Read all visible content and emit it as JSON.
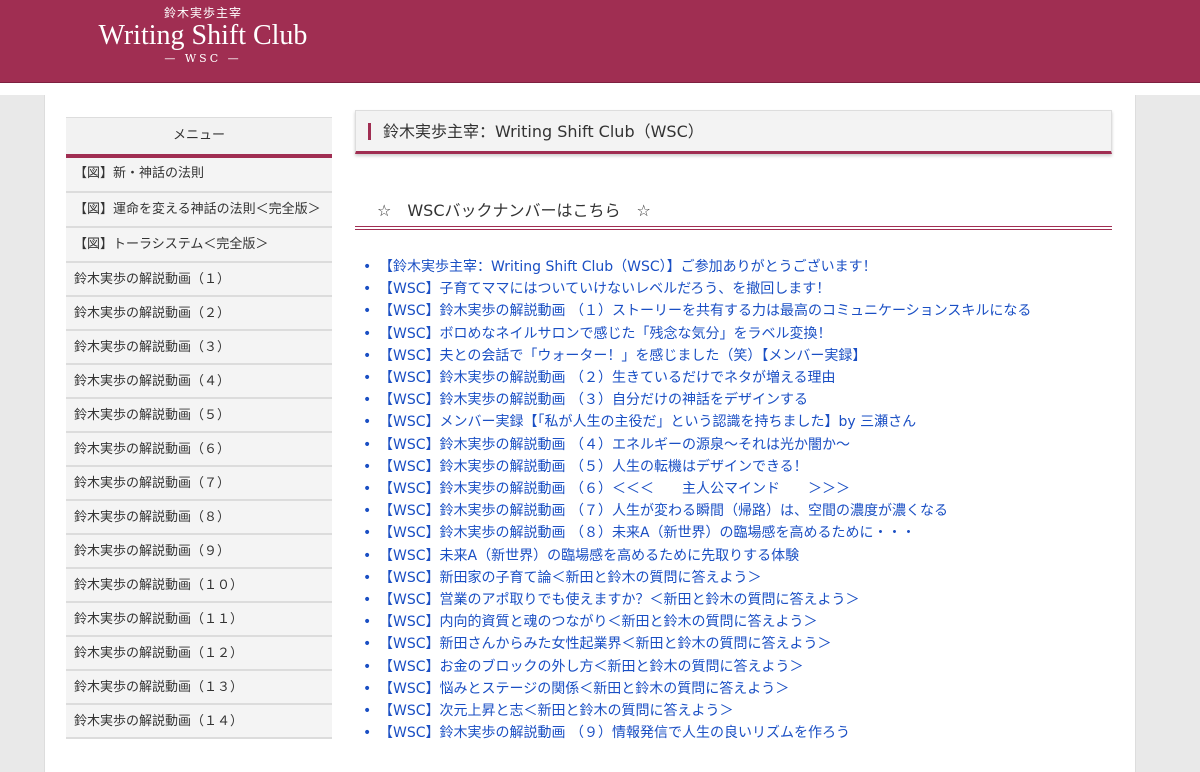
{
  "header": {
    "logo_top": "鈴木実歩主宰",
    "logo_main": "Writing Shift Club",
    "logo_sub": "— WSC —"
  },
  "sidebar": {
    "title": "メニュー",
    "items": [
      "【図】新・神話の法則",
      "【図】運命を変える神話の法則＜完全版＞",
      "【図】トーラシステム＜完全版＞",
      "鈴木実歩の解説動画（１）",
      "鈴木実歩の解説動画（２）",
      "鈴木実歩の解説動画（３）",
      "鈴木実歩の解説動画（４）",
      "鈴木実歩の解説動画（５）",
      "鈴木実歩の解説動画（６）",
      "鈴木実歩の解説動画（７）",
      "鈴木実歩の解説動画（８）",
      "鈴木実歩の解説動画（９）",
      "鈴木実歩の解説動画（１０）",
      "鈴木実歩の解説動画（１１）",
      "鈴木実歩の解説動画（１２）",
      "鈴木実歩の解説動画（１３）",
      "鈴木実歩の解説動画（１４）"
    ]
  },
  "main": {
    "page_title": "鈴木実歩主宰：Writing Shift Club（WSC）",
    "section_title": "☆　WSCバックナンバーはこちら　☆",
    "bullet": "•",
    "links": [
      "【鈴木実歩主宰：Writing Shift Club（WSC）】ご参加ありがとうございます！",
      "【WSC】子育てママにはついていけないレベルだろう、を撤回します！",
      "【WSC】鈴木実歩の解説動画 （１）ストーリーを共有する力は最高のコミュニケーションスキルになる",
      "【WSC】ボロめなネイルサロンで感じた「残念な気分」をラベル変換！",
      "【WSC】夫との会話で「ウォーター！」を感じました（笑）【メンバー実録】",
      "【WSC】鈴木実歩の解説動画 （２）生きているだけでネタが増える理由",
      "【WSC】鈴木実歩の解説動画 （３）自分だけの神話をデザインする",
      "【WSC】メンバー実録【「私が人生の主役だ」という認識を持ちました】by 三瀬さん",
      "【WSC】鈴木実歩の解説動画 （４）エネルギーの源泉〜それは光か闇か〜",
      "【WSC】鈴木実歩の解説動画 （５）人生の転機はデザインできる！",
      "【WSC】鈴木実歩の解説動画 （６）＜＜＜　　主人公マインド　　＞＞＞",
      "【WSC】鈴木実歩の解説動画 （７）人生が変わる瞬間（帰路）は、空間の濃度が濃くなる",
      "【WSC】鈴木実歩の解説動画 （８）未来A（新世界）の臨場感を高めるために・・・",
      "【WSC】未来A（新世界）の臨場感を高めるために先取りする体験",
      "【WSC】新田家の子育て論＜新田と鈴木の質問に答えよう＞",
      "【WSC】営業のアポ取りでも使えますか？＜新田と鈴木の質問に答えよう＞",
      "【WSC】内向的資質と魂のつながり＜新田と鈴木の質問に答えよう＞",
      "【WSC】新田さんからみた女性起業界＜新田と鈴木の質問に答えよう＞",
      "【WSC】お金のブロックの外し方＜新田と鈴木の質問に答えよう＞",
      "【WSC】悩みとステージの関係＜新田と鈴木の質問に答えよう＞",
      "【WSC】次元上昇と志＜新田と鈴木の質問に答えよう＞",
      "【WSC】鈴木実歩の解説動画 （９）情報発信で人生の良いリズムを作ろう"
    ]
  },
  "colors": {
    "brand": "#a02e52",
    "link": "#1a4fc4"
  }
}
